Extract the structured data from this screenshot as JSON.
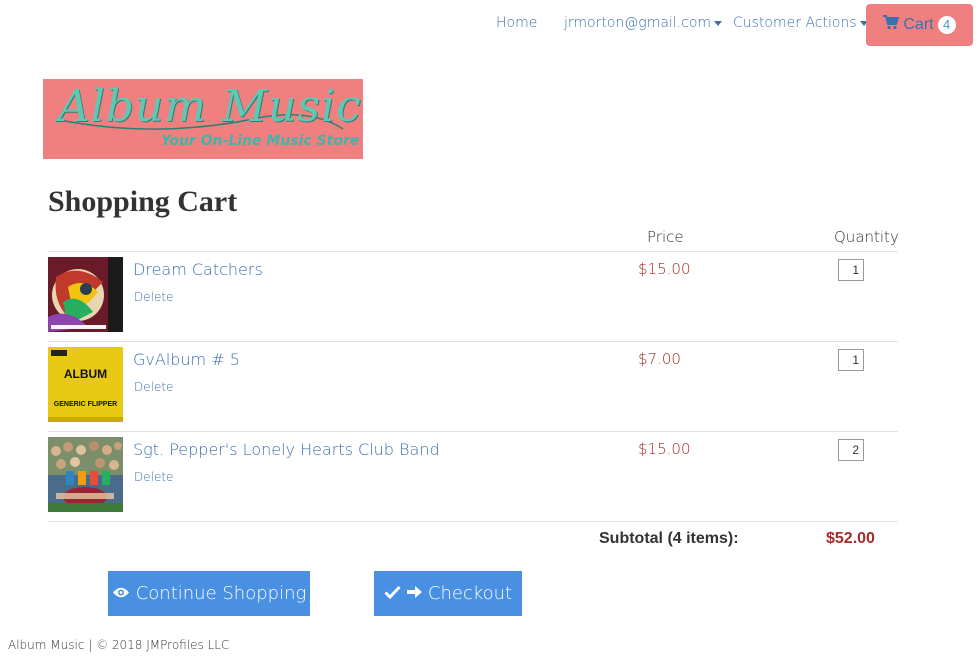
{
  "nav": {
    "home": "Home",
    "user": "jrmorton@gmail.com",
    "customer_actions": "Customer Actions",
    "cart_label": "Cart",
    "cart_count": "4"
  },
  "logo": {
    "name": "Album Music",
    "tagline": "Your On-Line Music Store"
  },
  "page": {
    "title": "Shopping Cart",
    "col_price": "Price",
    "col_quantity": "Quantity"
  },
  "items": [
    {
      "title": "Dream Catchers",
      "delete": "Delete",
      "price": "$15.00",
      "quantity": "1"
    },
    {
      "title": "GvAlbum # 5",
      "delete": "Delete",
      "price": "$7.00",
      "quantity": "1",
      "art_text_1": "ALBUM",
      "art_text_2": "GENERIC FLIPPER"
    },
    {
      "title": "Sgt. Pepper's Lonely Hearts Club Band",
      "delete": "Delete",
      "price": "$15.00",
      "quantity": "2"
    }
  ],
  "summary": {
    "subtotal_label": "Subtotal (4 items):",
    "subtotal_value": "$52.00"
  },
  "buttons": {
    "continue": "Continue Shopping",
    "checkout": "Checkout"
  },
  "footer": {
    "text": "Album Music | © 2018 JMProfiles LLC"
  },
  "colors": {
    "link": "#3c6fb0",
    "cart_button": "#f08080",
    "price": "#a52a2a",
    "primary_button": "#4a90e2"
  }
}
